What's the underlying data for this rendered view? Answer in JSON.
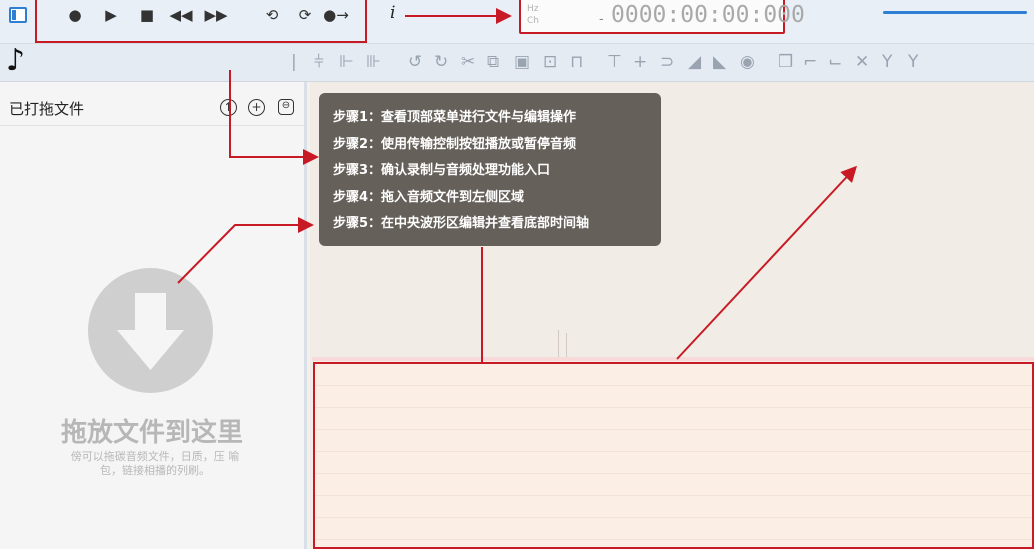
{
  "transport": {
    "record_icon": "record-icon",
    "play_icon": "play-icon",
    "stop_icon": "stop-icon",
    "rewind_icon": "rewind-icon",
    "forward_icon": "fast-forward-icon",
    "loop_icon": "loop-icon",
    "loop_add_icon": "loop-add-icon",
    "skip_icon": "skip-to-end-icon",
    "info_icon": "i"
  },
  "time_display": {
    "label_top": "Hz",
    "label_bottom": "Ch",
    "sign": "-",
    "value": "0000:00:00:000"
  },
  "colors": {
    "accent": "#2d7fd3",
    "annotation_red": "#c71a24",
    "tooltip_bg": "#5e5852"
  },
  "toolbar_icons": [
    "|",
    "⫩",
    "⊩",
    "⊪",
    "↺",
    "↻",
    "✂",
    "⧉",
    "▣",
    "⊡",
    "⊓",
    "⊤",
    "+",
    "⊃",
    "◢",
    "◣",
    "◉",
    "❒",
    "⌐",
    "⌙",
    "✕",
    "Y",
    "Y"
  ],
  "left_panel": {
    "title": "已打拖文件",
    "drop_title": "拖放文件到这里",
    "drop_hint": "傍可以拖碳音频文件，日质，压 喻包，链接相播的列刷。"
  },
  "guide": {
    "steps": [
      "步骤1：查看顶部菜单进行文件与编辑操作",
      "步骤2：使用传输控制按钮播放或暂停音频",
      "步骤3：确认录制与音频处理功能入口",
      "步骤4：拖入音频文件到左侧区域",
      "步骤5：在中央波形区编辑并查看底部时间轴"
    ]
  }
}
